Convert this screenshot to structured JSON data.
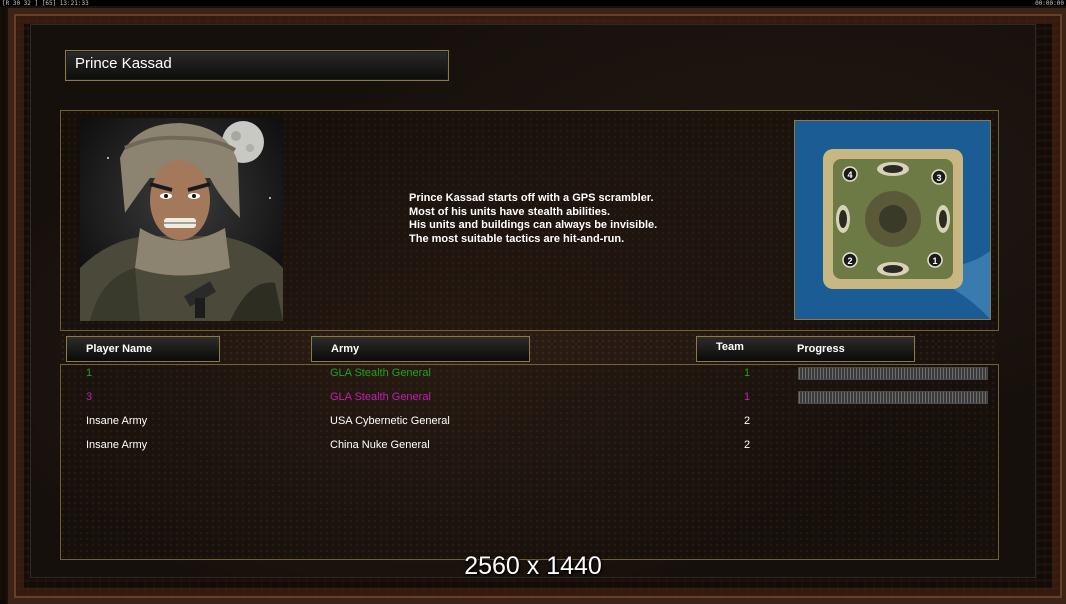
{
  "status_bar": {
    "left_text": "[R 30 32 ] [65] 13:21:33",
    "right_text": "00:00:00"
  },
  "general": {
    "name": "Prince Kassad",
    "description": [
      "Prince Kassad starts off with a GPS scrambler.",
      "Most of his units have stealth abilities.",
      "His units and buildings can always be invisible.",
      "The most suitable tactics are hit-and-run."
    ]
  },
  "minimap": {
    "start_positions": [
      "4",
      "3",
      "2",
      "1"
    ]
  },
  "columns": {
    "player_name": "Player Name",
    "army": "Army",
    "team": "Team",
    "progress": "Progress"
  },
  "players": [
    {
      "name": "1",
      "army": "GLA Stealth General",
      "team": "1",
      "color": "#1fa11f",
      "progress": 1.0
    },
    {
      "name": "3",
      "army": "GLA Stealth General",
      "team": "1",
      "color": "#c01fb0",
      "progress": 1.0
    },
    {
      "name": "Insane Army",
      "army": "USA Cybernetic General",
      "team": "2",
      "color": "#ffffff"
    },
    {
      "name": "Insane Army",
      "army": "China Nuke General",
      "team": "2",
      "color": "#ffffff"
    }
  ],
  "resolution_label": "2560 x 1440"
}
